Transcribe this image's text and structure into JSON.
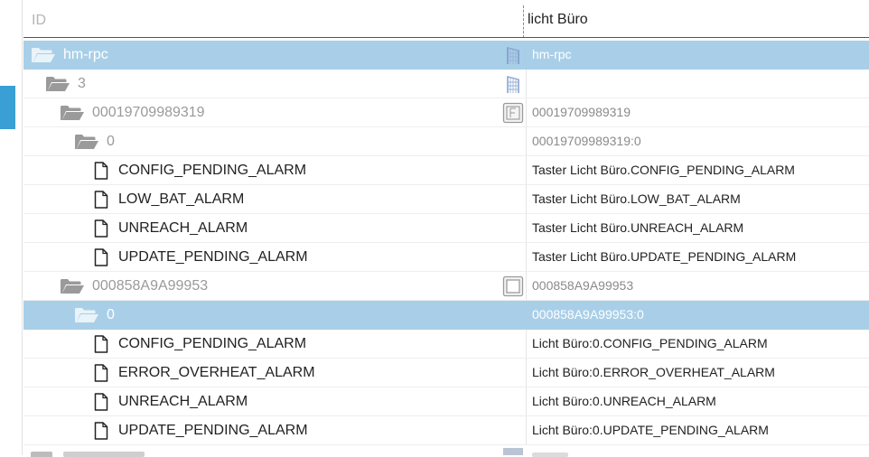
{
  "header": {
    "id_label": "ID",
    "filter_value": "licht Büro"
  },
  "rows": [
    {
      "kind": "folder",
      "depth": 0,
      "name": "hm-rpc",
      "value": "hm-rpc",
      "type_icon": "building-icon",
      "selected": true
    },
    {
      "kind": "folder",
      "depth": 1,
      "name": "3",
      "value": "",
      "type_icon": "building-icon",
      "selected": false
    },
    {
      "kind": "folder",
      "depth": 2,
      "name": "00019709989319",
      "value": "00019709989319",
      "type_icon": "device-icon",
      "selected": false
    },
    {
      "kind": "folder",
      "depth": 3,
      "name": "0",
      "value": "00019709989319:0",
      "type_icon": "",
      "selected": false
    },
    {
      "kind": "file",
      "depth": 4,
      "name": "CONFIG_PENDING_ALARM",
      "value": "Taster Licht Büro.CONFIG_PENDING_ALARM"
    },
    {
      "kind": "file",
      "depth": 4,
      "name": "LOW_BAT_ALARM",
      "value": "Taster Licht Büro.LOW_BAT_ALARM"
    },
    {
      "kind": "file",
      "depth": 4,
      "name": "UNREACH_ALARM",
      "value": "Taster Licht Büro.UNREACH_ALARM"
    },
    {
      "kind": "file",
      "depth": 4,
      "name": "UPDATE_PENDING_ALARM",
      "value": "Taster Licht Büro.UPDATE_PENDING_ALARM"
    },
    {
      "kind": "folder",
      "depth": 2,
      "name": "000858A9A99953",
      "value": "000858A9A99953",
      "type_icon": "switch-device-icon",
      "selected": false
    },
    {
      "kind": "folder",
      "depth": 3,
      "name": "0",
      "value": "000858A9A99953:0",
      "type_icon": "",
      "selected": true
    },
    {
      "kind": "file",
      "depth": 4,
      "name": "CONFIG_PENDING_ALARM",
      "value": "Licht Büro:0.CONFIG_PENDING_ALARM"
    },
    {
      "kind": "file",
      "depth": 4,
      "name": "ERROR_OVERHEAT_ALARM",
      "value": "Licht Büro:0.ERROR_OVERHEAT_ALARM"
    },
    {
      "kind": "file",
      "depth": 4,
      "name": "UNREACH_ALARM",
      "value": "Licht Büro:0.UNREACH_ALARM"
    },
    {
      "kind": "file",
      "depth": 4,
      "name": "UPDATE_PENDING_ALARM",
      "value": "Licht Büro:0.UPDATE_PENDING_ALARM"
    }
  ],
  "colors": {
    "selected_row": "#a9cfe8",
    "side_tab": "#3a9fd4",
    "folder_icon": "#9a9a9a",
    "folder_icon_selected": "#e9f3fa"
  }
}
